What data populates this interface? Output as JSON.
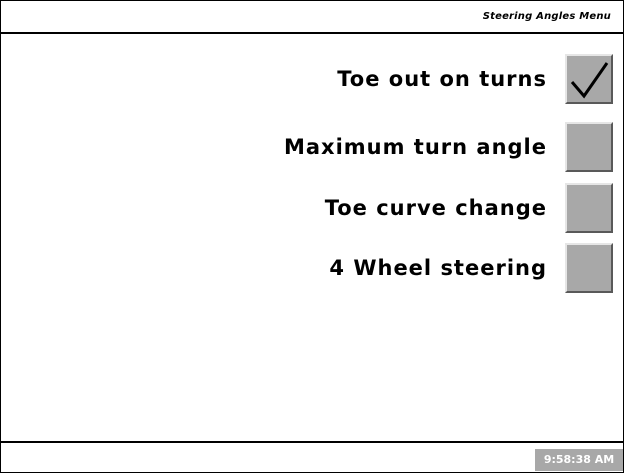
{
  "header": {
    "title": "Steering Angles Menu"
  },
  "options": [
    {
      "label": "Toe out on turns",
      "checked": true
    },
    {
      "label": "Maximum turn angle",
      "checked": false
    },
    {
      "label": "Toe curve change",
      "checked": false
    },
    {
      "label": "4 Wheel steering",
      "checked": false
    }
  ],
  "status": {
    "time": "9:58:38 AM"
  },
  "colors": {
    "checkbox_fill": "#a8a8a8",
    "clock_bg": "#a8a8a8",
    "clock_text": "#ffffff"
  },
  "icons": {
    "checked": "checkmark-icon"
  }
}
